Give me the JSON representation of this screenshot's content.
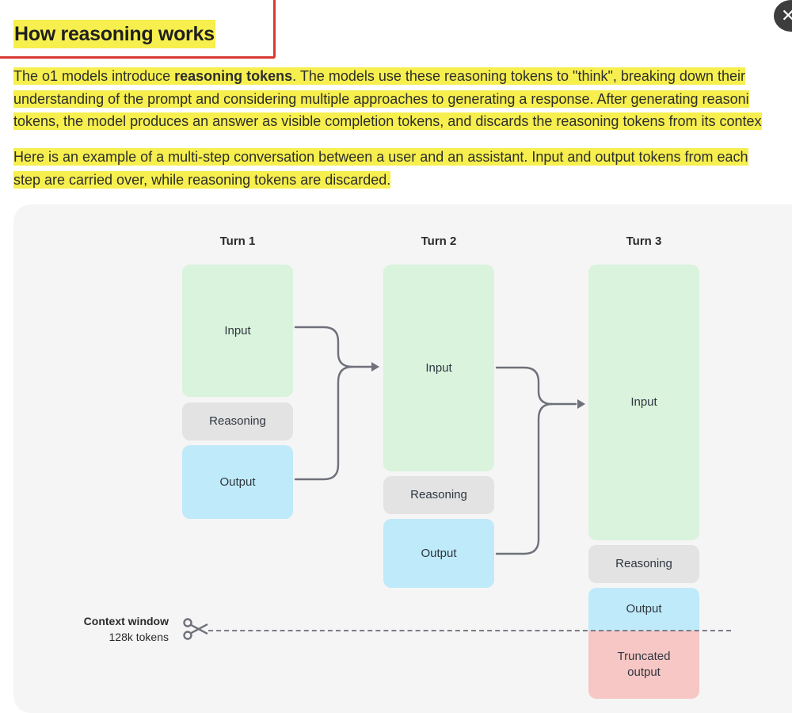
{
  "header": {
    "title": "How reasoning works",
    "close_icon": "close-icon"
  },
  "paragraphs": {
    "intro": {
      "line1_pre": "The o1 models introduce ",
      "line1_bold": "reasoning tokens",
      "line1_post": ". The models use these reasoning tokens to \"think\", breaking down their",
      "line2": "understanding of the prompt and considering multiple approaches to generating a response. After generating reasoni",
      "line3": "tokens, the model produces an answer as visible completion tokens, and discards the reasoning tokens from its contex"
    },
    "example": {
      "line1": "Here is an example of a multi-step conversation between a user and an assistant. Input and output tokens from each",
      "line2": "step are carried over, while reasoning tokens are discarded."
    }
  },
  "diagram": {
    "turns": [
      {
        "label": "Turn 1",
        "blocks": {
          "input": "Input",
          "reasoning": "Reasoning",
          "output": "Output"
        }
      },
      {
        "label": "Turn 2",
        "blocks": {
          "input": "Input",
          "reasoning": "Reasoning",
          "output": "Output"
        }
      },
      {
        "label": "Turn 3",
        "blocks": {
          "input": "Input",
          "reasoning": "Reasoning",
          "output": "Output",
          "truncated_line1": "Truncated",
          "truncated_line2": "output"
        }
      }
    ],
    "context_window": {
      "title": "Context window",
      "size": "128k tokens",
      "icon": "scissors-icon"
    },
    "colors": {
      "input": "#d9f3dc",
      "reasoning": "#e3e3e3",
      "output": "#bfeaf9",
      "truncated": "#f6c7c4",
      "arrow": "#6e707a",
      "highlight": "#f6ef4e",
      "frame": "#d93a35"
    }
  }
}
